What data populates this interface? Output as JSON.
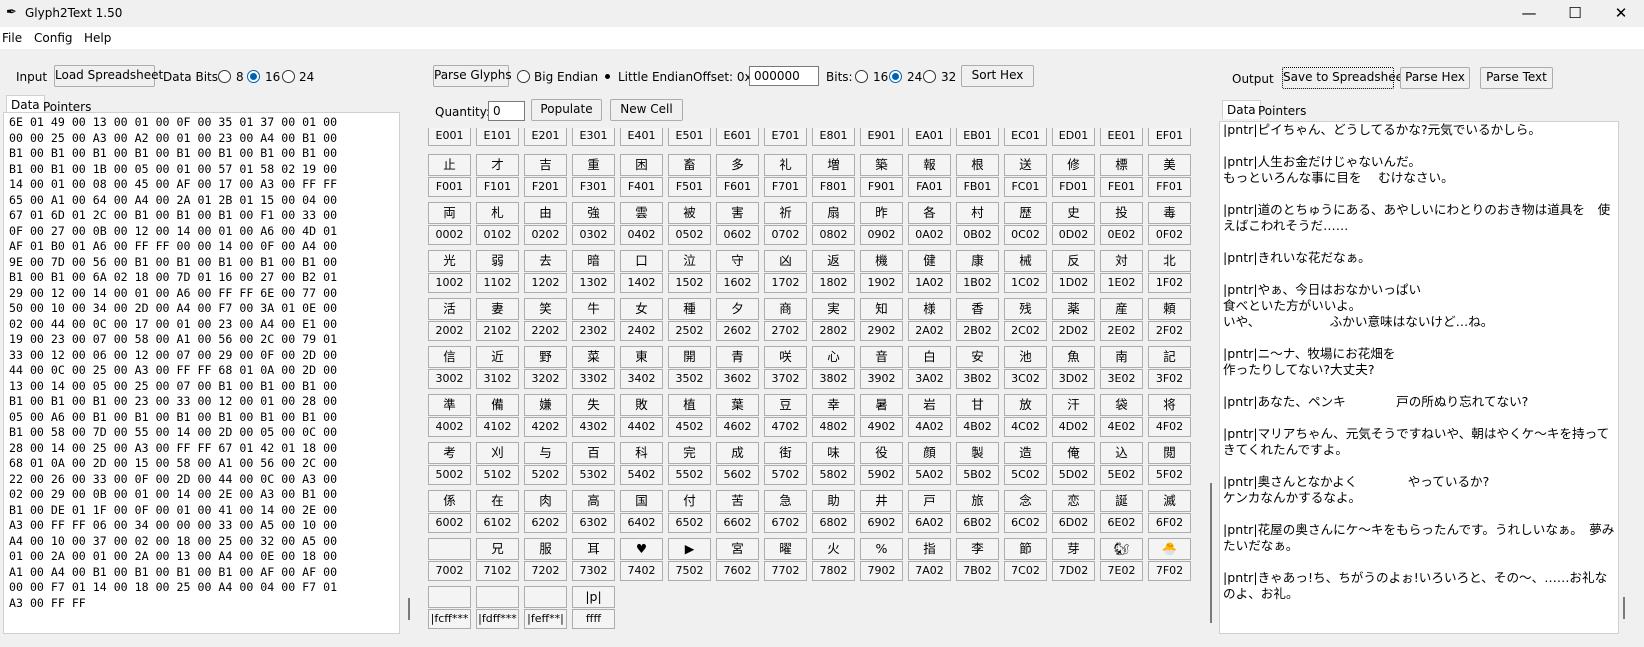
{
  "window": {
    "title": "Glyph2Text 1.50",
    "icon": "feather-icon"
  },
  "menu": [
    "File",
    "Config",
    "Help"
  ],
  "input": {
    "label": "Input",
    "load_button": "Load Spreadsheet",
    "data_bits_label": "Data Bits:",
    "data_bits_options": [
      "8",
      "16",
      "24"
    ],
    "data_bits_selected": "16",
    "tabs": [
      "Data",
      "Pointers"
    ],
    "hex_lines": [
      "6E 01 49 00 13 00 01 00 0F 00 35 01 37 00 01 00",
      "00 00 25 00 A3 00 A2 00 01 00 23 00 A4 00 B1 00",
      "B1 00 B1 00 B1 00 B1 00 B1 00 B1 00 B1 00 B1 00",
      "B1 00 B1 00 1B 00 05 00 01 00 57 01 58 02 19 00",
      "14 00 01 00 08 00 45 00 AF 00 17 00 A3 00 FF FF",
      "65 00 A1 00 64 00 A4 00 2A 01 2B 01 15 00 04 00",
      "67 01 6D 01 2C 00 B1 00 B1 00 B1 00 F1 00 33 00",
      "0F 00 27 00 0B 00 12 00 14 00 01 00 A6 00 4D 01",
      "AF 01 B0 01 A6 00 FF FF 00 00 14 00 0F 00 A4 00",
      "9E 00 7D 00 56 00 B1 00 B1 00 B1 00 B1 00 B1 00",
      "B1 00 B1 00 6A 02 18 00 7D 01 16 00 27 00 B2 01",
      "29 00 12 00 14 00 01 00 A6 00 FF FF 6E 00 77 00",
      "50 00 10 00 34 00 2D 00 A4 00 F7 00 3A 01 0E 00",
      "02 00 44 00 0C 00 17 00 01 00 23 00 A4 00 E1 00",
      "19 00 23 00 07 00 58 00 A1 00 56 00 2C 00 79 01",
      "33 00 12 00 06 00 12 00 07 00 29 00 0F 00 2D 00",
      "44 00 0C 00 25 00 A3 00 FF FF 68 01 0A 00 2D 00",
      "13 00 14 00 05 00 25 00 07 00 B1 00 B1 00 B1 00",
      "B1 00 B1 00 B1 00 23 00 33 00 12 00 01 00 28 00",
      "05 00 A6 00 B1 00 B1 00 B1 00 B1 00 B1 00 B1 00",
      "B1 00 58 00 7D 00 55 00 14 00 2D 00 05 00 0C 00",
      "28 00 14 00 25 00 A3 00 FF FF 67 01 42 01 18 00",
      "68 01 0A 00 2D 00 15 00 58 00 A1 00 56 00 2C 00",
      "22 00 26 00 33 00 0F 00 2D 00 44 00 0C 00 A3 00",
      "02 00 29 00 0B 00 01 00 14 00 2E 00 A3 00 B1 00",
      "B1 00 DE 01 1F 00 0F 00 01 00 41 00 14 00 2E 00",
      "A3 00 FF FF 06 00 34 00 00 00 33 00 A5 00 10 00",
      "A4 00 10 00 37 00 02 00 18 00 25 00 32 00 A5 00",
      "01 00 2A 00 01 00 2A 00 13 00 A4 00 0E 00 18 00",
      "A1 00 A4 00 B1 00 B1 00 B1 00 B1 00 AF 00 AF 00",
      "00 00 F7 01 14 00 18 00 25 00 A4 00 04 00 F7 01",
      "A3 00 FF FF"
    ]
  },
  "glyphs": {
    "parse_button": "Parse Glyphs",
    "endian_options": [
      "Big Endian",
      "Little Endian"
    ],
    "endian_selected": "Little Endian",
    "offset_label": "Offset: 0x",
    "offset_value": "000000",
    "bits_label": "Bits:",
    "bits_options": [
      "16",
      "24",
      "32"
    ],
    "bits_selected": "24",
    "sort_button": "Sort Hex",
    "quantity_label": "Quantity:",
    "quantity_value": "0",
    "populate_button": "Populate",
    "new_cell_button": "New Cell",
    "top_codes": [
      "E001",
      "E101",
      "E201",
      "E301",
      "E401",
      "E501",
      "E601",
      "E701",
      "E801",
      "E901",
      "EA01",
      "EB01",
      "EC01",
      "ED01",
      "EE01",
      "EF01"
    ],
    "rows": [
      {
        "glyphs": [
          "止",
          "才",
          "吉",
          "重",
          "困",
          "畜",
          "多",
          "礼",
          "増",
          "築",
          "報",
          "根",
          "送",
          "修",
          "標",
          "美"
        ],
        "codes": [
          "F001",
          "F101",
          "F201",
          "F301",
          "F401",
          "F501",
          "F601",
          "F701",
          "F801",
          "F901",
          "FA01",
          "FB01",
          "FC01",
          "FD01",
          "FE01",
          "FF01"
        ]
      },
      {
        "glyphs": [
          "両",
          "札",
          "由",
          "強",
          "雲",
          "被",
          "害",
          "祈",
          "扇",
          "昨",
          "各",
          "村",
          "歴",
          "史",
          "投",
          "毒"
        ],
        "codes": [
          "0002",
          "0102",
          "0202",
          "0302",
          "0402",
          "0502",
          "0602",
          "0702",
          "0802",
          "0902",
          "0A02",
          "0B02",
          "0C02",
          "0D02",
          "0E02",
          "0F02"
        ]
      },
      {
        "glyphs": [
          "光",
          "弱",
          "去",
          "暗",
          "口",
          "泣",
          "守",
          "凶",
          "返",
          "機",
          "健",
          "康",
          "械",
          "反",
          "対",
          "北"
        ],
        "codes": [
          "1002",
          "1102",
          "1202",
          "1302",
          "1402",
          "1502",
          "1602",
          "1702",
          "1802",
          "1902",
          "1A02",
          "1B02",
          "1C02",
          "1D02",
          "1E02",
          "1F02"
        ]
      },
      {
        "glyphs": [
          "活",
          "妻",
          "笑",
          "牛",
          "女",
          "種",
          "夕",
          "商",
          "実",
          "知",
          "様",
          "香",
          "残",
          "薬",
          "産",
          "頼"
        ],
        "codes": [
          "2002",
          "2102",
          "2202",
          "2302",
          "2402",
          "2502",
          "2602",
          "2702",
          "2802",
          "2902",
          "2A02",
          "2B02",
          "2C02",
          "2D02",
          "2E02",
          "2F02"
        ]
      },
      {
        "glyphs": [
          "信",
          "近",
          "野",
          "菜",
          "東",
          "開",
          "青",
          "咲",
          "心",
          "音",
          "白",
          "安",
          "池",
          "魚",
          "南",
          "記"
        ],
        "codes": [
          "3002",
          "3102",
          "3202",
          "3302",
          "3402",
          "3502",
          "3602",
          "3702",
          "3802",
          "3902",
          "3A02",
          "3B02",
          "3C02",
          "3D02",
          "3E02",
          "3F02"
        ]
      },
      {
        "glyphs": [
          "準",
          "備",
          "嫌",
          "失",
          "敗",
          "植",
          "葉",
          "豆",
          "幸",
          "暑",
          "岩",
          "甘",
          "放",
          "汗",
          "袋",
          "将"
        ],
        "codes": [
          "4002",
          "4102",
          "4202",
          "4302",
          "4402",
          "4502",
          "4602",
          "4702",
          "4802",
          "4902",
          "4A02",
          "4B02",
          "4C02",
          "4D02",
          "4E02",
          "4F02"
        ]
      },
      {
        "glyphs": [
          "考",
          "刈",
          "与",
          "百",
          "科",
          "完",
          "成",
          "街",
          "味",
          "役",
          "顔",
          "製",
          "造",
          "俺",
          "込",
          "閲"
        ],
        "codes": [
          "5002",
          "5102",
          "5202",
          "5302",
          "5402",
          "5502",
          "5602",
          "5702",
          "5802",
          "5902",
          "5A02",
          "5B02",
          "5C02",
          "5D02",
          "5E02",
          "5F02"
        ]
      },
      {
        "glyphs": [
          "係",
          "在",
          "肉",
          "高",
          "国",
          "付",
          "苦",
          "急",
          "助",
          "井",
          "戸",
          "旅",
          "念",
          "恋",
          "誕",
          "滅"
        ],
        "codes": [
          "6002",
          "6102",
          "6202",
          "6302",
          "6402",
          "6502",
          "6602",
          "6702",
          "6802",
          "6902",
          "6A02",
          "6B02",
          "6C02",
          "6D02",
          "6E02",
          "6F02"
        ]
      },
      {
        "glyphs": [
          "",
          "兄",
          "服",
          "耳",
          "♥",
          "▶",
          "宮",
          "曜",
          "火",
          "%",
          "指",
          "李",
          "節",
          "芽",
          "🐿",
          "🐣"
        ],
        "codes": [
          "7002",
          "7102",
          "7202",
          "7302",
          "7402",
          "7502",
          "7602",
          "7702",
          "7802",
          "7902",
          "7A02",
          "7B02",
          "7C02",
          "7D02",
          "7E02",
          "7F02"
        ]
      },
      {
        "glyphs": [
          "",
          "",
          "",
          "|p|"
        ],
        "codes": [
          "|fcff***",
          "|fdff***",
          "|feff**|",
          "ffff"
        ]
      }
    ]
  },
  "output": {
    "label": "Output",
    "save_button": "Save to Spreadsheet",
    "parse_hex_button": "Parse Hex",
    "parse_text_button": "Parse Text",
    "tabs": [
      "Data",
      "Pointers"
    ],
    "text": "|pntr|ピイちゃん、どうしてるかな?元気でいるかしら。\n\n|pntr|人生お金だけじゃないんだ。\nもっといろんな事に目を　 むけなさい。\n\n|pntr|道のとちゅうにある、あやしいにわとりのおき物は道具を　使えばこわれそうだ……\n\n|pntr|きれいな花だなぁ。\n\n|pntr|やぁ、今日はおなかいっぱい\n食べといた方がいいよ。\nいや、　　　　　　ふかい意味はないけど…ね。\n\n|pntr|ニ～ナ、牧場にお花畑を\n作ったりしてない?大丈夫?\n\n|pntr|あなた、ペンキ　　　　戸の所ぬり忘れてない?\n\n|pntr|マリアちゃん、元気そうですねいや、朝はやくケ～キを持ってきてくれたんですよ。\n\n|pntr|奥さんとなかよく　　　　やっているか?\nケンカなんかするなよ。\n\n|pntr|花屋の奥さんにケ～キをもらったんです。うれしいなぁ。　夢みたいだなぁ。\n\n|pntr|きゃあっ!ち、ちがうのよぉ!いろいろと、その～、……お礼なのよ、お礼。"
  }
}
